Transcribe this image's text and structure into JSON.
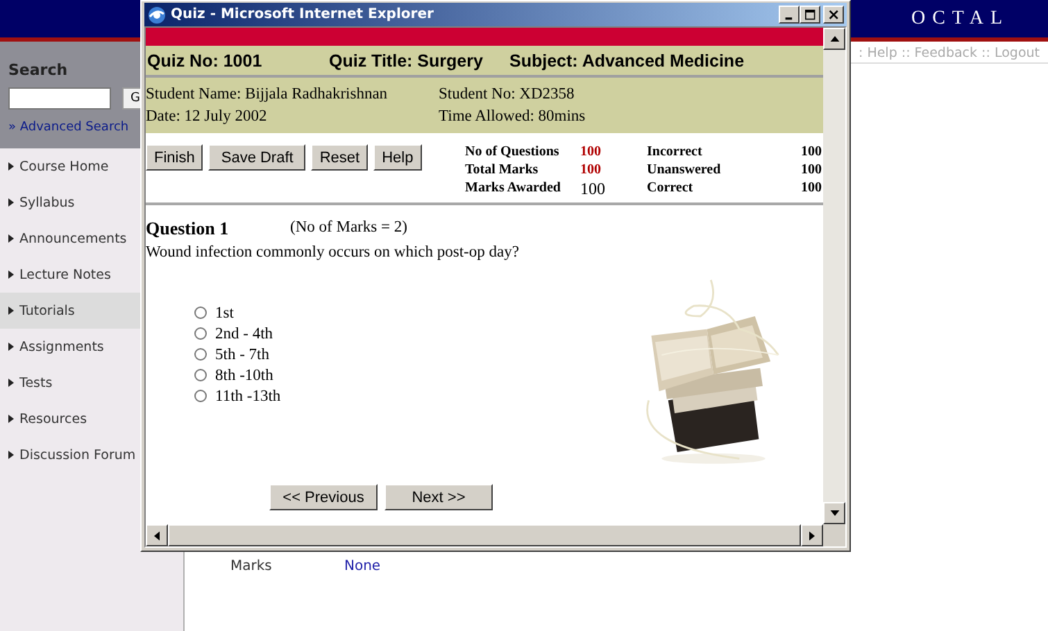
{
  "background": {
    "brand": "OCTAL",
    "top_links": ": Help :: Feedback :: Logout",
    "search": {
      "title": "Search",
      "button": "G",
      "link": "» Advanced Search"
    },
    "nav": [
      {
        "label": "Course Home",
        "selected": false
      },
      {
        "label": "Syllabus",
        "selected": false
      },
      {
        "label": "Announcements",
        "selected": false
      },
      {
        "label": "Lecture Notes",
        "selected": false
      },
      {
        "label": "Tutorials",
        "selected": true
      },
      {
        "label": "Assignments",
        "selected": false
      },
      {
        "label": "Tests",
        "selected": false
      },
      {
        "label": "Resources",
        "selected": false
      },
      {
        "label": "Discussion Forum",
        "selected": false
      }
    ],
    "detail": {
      "label": "Marks",
      "value": "None"
    }
  },
  "window": {
    "title": "Quiz - Microsoft Internet Explorer",
    "quiz_header": {
      "quiz_no": "Quiz No: 1001",
      "quiz_title": "Quiz Title: Surgery",
      "subject": "Subject: Advanced Medicine"
    },
    "student": {
      "name": "Student Name: Bijjala Radhakrishnan",
      "number": "Student No: XD2358",
      "date": "Date: 12 July 2002",
      "time_allowed": "Time Allowed: 80mins"
    },
    "actions": [
      "Finish",
      "Save Draft",
      "Reset",
      "Help"
    ],
    "stats": [
      {
        "label": "No of Questions",
        "value": "100",
        "kind": "alert"
      },
      {
        "label": "Incorrect",
        "value": "100",
        "kind": "bold"
      },
      {
        "label": "Total Marks",
        "value": "100",
        "kind": "alert"
      },
      {
        "label": "Unanswered",
        "value": "100",
        "kind": "bold"
      },
      {
        "label": "Marks Awarded",
        "value": "100",
        "kind": "plain"
      },
      {
        "label": "Correct",
        "value": "100",
        "kind": "bold"
      }
    ],
    "question": {
      "title": "Question 1",
      "marks": "(No of Marks = 2)",
      "text": "Wound infection commonly occurs on which post-op day?",
      "options": [
        {
          "label": "1st",
          "selected": false
        },
        {
          "label": "2nd - 4th",
          "selected": false
        },
        {
          "label": "5th - 7th",
          "selected": false
        },
        {
          "label": "8th -10th",
          "selected": false
        },
        {
          "label": "11th -13th",
          "selected": false
        }
      ]
    },
    "nav_buttons": [
      "<< Previous",
      "Next >>"
    ]
  }
}
